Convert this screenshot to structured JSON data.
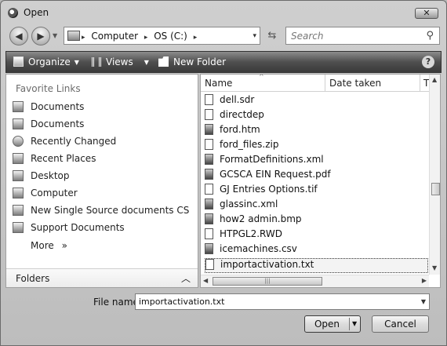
{
  "window": {
    "title": "Open",
    "close_label": "✕"
  },
  "address_bar": {
    "segments": [
      "Computer",
      "OS (C:)"
    ],
    "separator": "▸",
    "dropdown_glyph": "▾",
    "refresh_glyph": "⇆"
  },
  "search": {
    "placeholder": "Search",
    "icon_glyph": "⚲"
  },
  "toolbar": {
    "organize_label": "Organize",
    "views_label": "Views",
    "new_folder_label": "New Folder",
    "help_glyph": "?",
    "caret_glyph": "▼"
  },
  "nav_pane": {
    "title": "Favorite Links",
    "items": [
      {
        "label": "Documents",
        "icon": "documents-icon"
      },
      {
        "label": "Documents",
        "icon": "documents-icon"
      },
      {
        "label": "Recently Changed",
        "icon": "recently-changed-icon"
      },
      {
        "label": "Recent Places",
        "icon": "recent-places-icon"
      },
      {
        "label": "Desktop",
        "icon": "desktop-icon"
      },
      {
        "label": "Computer",
        "icon": "computer-icon"
      },
      {
        "label": "New Single Source documents CS",
        "icon": "folder-icon"
      },
      {
        "label": "Support Documents",
        "icon": "folder-icon"
      }
    ],
    "more_label": "More",
    "more_glyph": "»",
    "folders_label": "Folders",
    "folders_glyph": "︿"
  },
  "file_list": {
    "columns": [
      "Name",
      "Date taken",
      "T"
    ],
    "sort_glyph": "^",
    "files": [
      {
        "name": "dell.sdr",
        "icon": "file-icon"
      },
      {
        "name": "directdep",
        "icon": "file-icon"
      },
      {
        "name": "ford.htm",
        "icon": "html-file-icon"
      },
      {
        "name": "ford_files.zip",
        "icon": "zip-file-icon"
      },
      {
        "name": "FormatDefinitions.xml",
        "icon": "xml-file-icon"
      },
      {
        "name": "GCSCA EIN Request.pdf",
        "icon": "pdf-file-icon"
      },
      {
        "name": "GJ Entries Options.tif",
        "icon": "image-file-icon"
      },
      {
        "name": "glassinc.xml",
        "icon": "xml-file-icon"
      },
      {
        "name": "how2 admin.bmp",
        "icon": "image-file-icon"
      },
      {
        "name": "HTPGL2.RWD",
        "icon": "file-icon"
      },
      {
        "name": "icemachines.csv",
        "icon": "csv-file-icon"
      },
      {
        "name": "importactivation.txt",
        "icon": "text-file-icon"
      }
    ],
    "selected_name": "importactivation.txt"
  },
  "file_name": {
    "label": "File name:",
    "value": "importactivation.txt"
  },
  "buttons": {
    "open": "Open",
    "cancel": "Cancel"
  }
}
